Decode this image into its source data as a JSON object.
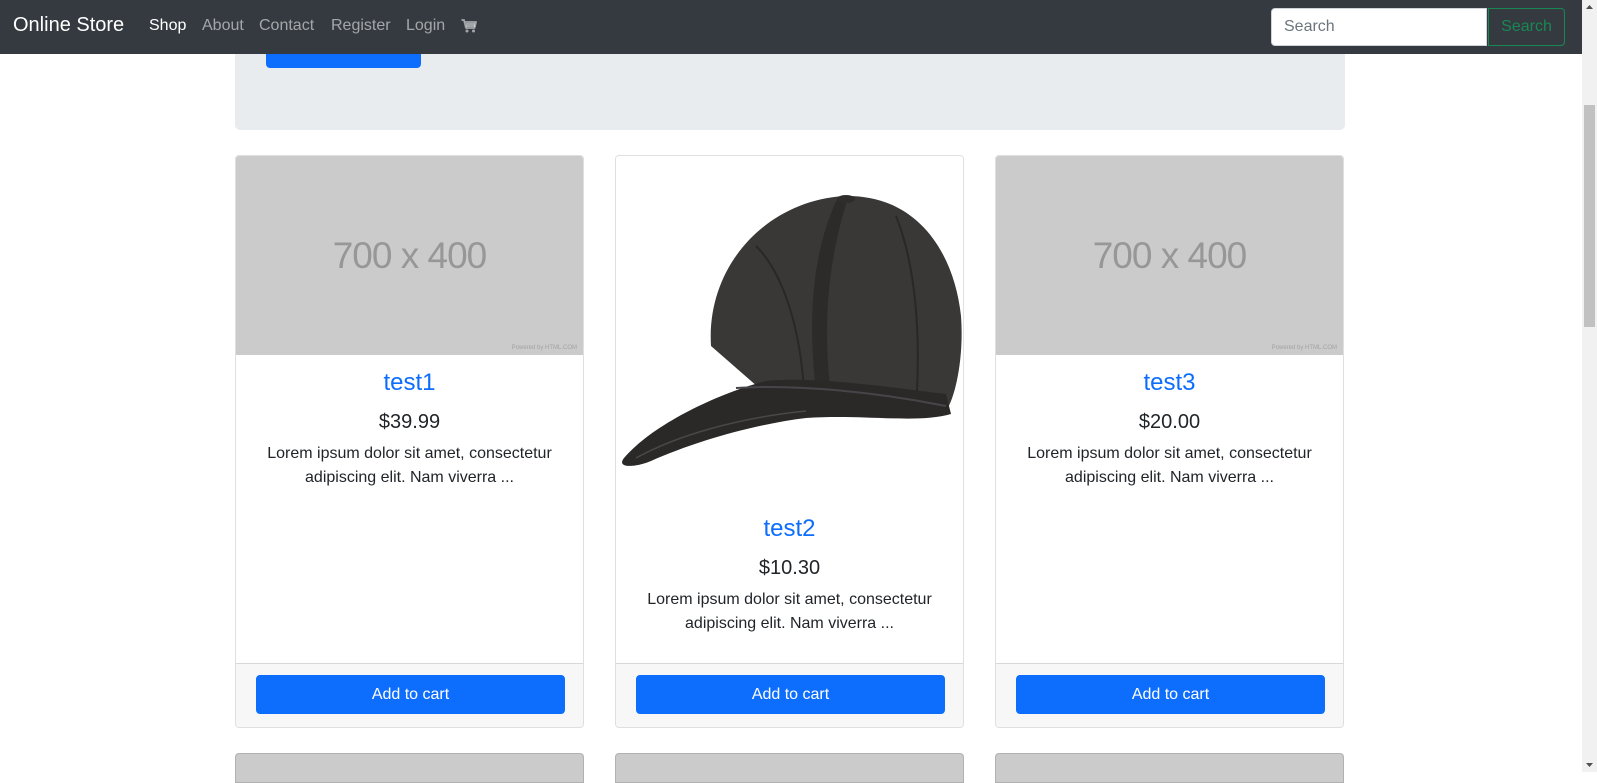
{
  "navbar": {
    "brand": "Online Store",
    "links": [
      {
        "label": "Shop"
      },
      {
        "label": "About"
      },
      {
        "label": "Contact"
      },
      {
        "label": "Register"
      },
      {
        "label": "Login"
      }
    ],
    "cart_icon": "shopping-cart-icon",
    "search": {
      "placeholder": "Search",
      "button_label": "Search"
    }
  },
  "products": [
    {
      "title": "test1",
      "price": "$39.99",
      "description": "Lorem ipsum dolor sit amet, consectetur adipiscing elit. Nam viverra ...",
      "image": {
        "type": "placeholder",
        "text": "700 x 400",
        "credit": "Powered by HTML.COM"
      },
      "button_label": "Add to cart"
    },
    {
      "title": "test2",
      "price": "$10.30",
      "description": "Lorem ipsum dolor sit amet, consectetur adipiscing elit. Nam viverra ...",
      "image": {
        "type": "photo",
        "subject": "black-baseball-cap"
      },
      "button_label": "Add to cart"
    },
    {
      "title": "test3",
      "price": "$20.00",
      "description": "Lorem ipsum dolor sit amet, consectetur adipiscing elit. Nam viverra ...",
      "image": {
        "type": "placeholder",
        "text": "700 x 400",
        "credit": "Powered by HTML.COM"
      },
      "button_label": "Add to cart"
    }
  ],
  "colors": {
    "navbar_bg": "#343a40",
    "primary": "#0d6efd",
    "success": "#198754",
    "jumbotron_bg": "#e9ecef",
    "placeholder_bg": "#cbcbcb"
  }
}
